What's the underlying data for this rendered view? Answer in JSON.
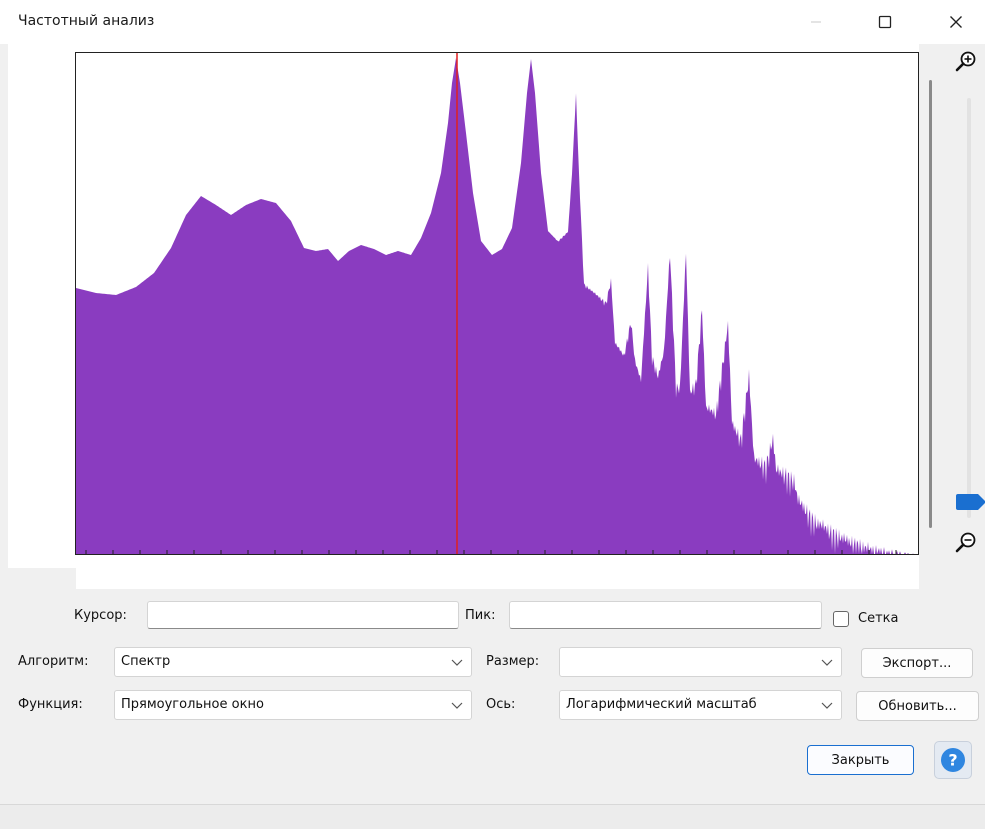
{
  "window": {
    "title": "Частотный анализ",
    "controls": [
      "minimize-icon",
      "maximize-icon",
      "close-icon"
    ]
  },
  "plot": {
    "fill_color": "#8a3cc0",
    "cursor_color": "#e02020",
    "axis": "Логарифмический масштаб",
    "x_ticks_shown": true,
    "labels_shown": false
  },
  "zoom": {
    "in_icon": "zoom-in-icon",
    "out_icon": "zoom-out-icon",
    "level": 0.05
  },
  "form": {
    "cursor_label": "Курсор:",
    "cursor_value": "",
    "peak_label": "Пик:",
    "peak_value": "",
    "grid_label": "Сетка",
    "grid_checked": false,
    "algorithm_label": "Алгоритм:",
    "algorithm_value": "Спектр",
    "size_label": "Размер:",
    "size_value": "",
    "function_label": "Функция:",
    "function_value": "Прямоугольное  окно",
    "axis_label": "Ось:",
    "axis_value": "Логарифмический масштаб"
  },
  "buttons": {
    "export": "Экспорт...",
    "refresh": "Обновить...",
    "close": "Закрыть",
    "help_icon": "help-icon"
  },
  "colors": {
    "accent": "#1a6fd0",
    "spectrum": "#8a3cc0",
    "cursor": "#e02020"
  }
}
